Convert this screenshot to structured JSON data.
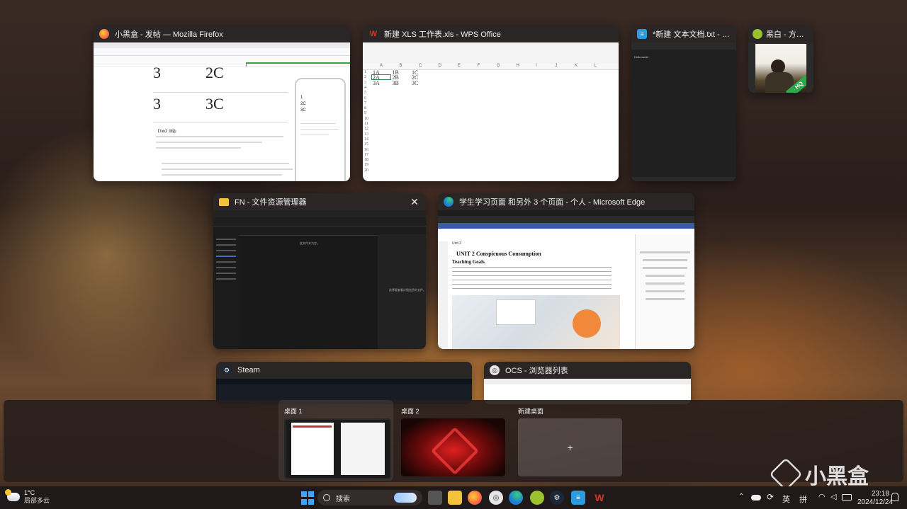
{
  "windows": {
    "firefox": {
      "title": "小黑盒 - 发帖 — Mozilla Firefox",
      "big1": "3",
      "big2": "2C",
      "big3": "3",
      "big4": "3C",
      "section": "【Tab】测验:",
      "phone_rows": [
        "1",
        "2C",
        "3C"
      ]
    },
    "wps": {
      "title": "新建 XLS 工作表.xls - WPS Office",
      "cols": [
        "A",
        "B",
        "C",
        "D",
        "E",
        "F",
        "G",
        "H",
        "I",
        "J",
        "K",
        "L"
      ],
      "rows": [
        [
          "1A",
          "1B",
          "1C"
        ],
        [
          "2A",
          "2B",
          "2C"
        ],
        [
          "3A",
          "3B",
          "3C"
        ]
      ],
      "row_numbers": [
        "1",
        "2",
        "3",
        "4",
        "5",
        "6",
        "7",
        "8",
        "9",
        "10",
        "11",
        "12",
        "13",
        "14",
        "15",
        "16",
        "17",
        "18",
        "19",
        "20"
      ]
    },
    "notepad": {
      "title": "*新建 文本文档.txt - Notepad",
      "content": "Hello world"
    },
    "music": {
      "title": "黑白 - 方大同",
      "badge": "HQ"
    },
    "explorer": {
      "title": "FN - 文件资源管理器",
      "close": "✕",
      "empty": "此文件夹为空。",
      "detail": "选择要查看详细信息的文件。"
    },
    "edge": {
      "title": "学生学习页面 和另外 3 个页面 - 个人 - Microsoft Edge",
      "unit": "Unit 2",
      "heading": "UNIT 2 Conspicuous Consumption",
      "subheading": "Teaching Goals"
    },
    "steam": {
      "title": "Steam"
    },
    "ocs": {
      "title": "OCS - 浏览器列表"
    }
  },
  "desktops": {
    "items": [
      {
        "label": "桌面 1"
      },
      {
        "label": "桌面 2"
      }
    ],
    "new_label": "新建桌面",
    "plus": "+"
  },
  "taskbar": {
    "weather_temp": "1°C",
    "weather_desc": "局部多云",
    "search_placeholder": "搜索",
    "ime1": "英",
    "ime2": "拼",
    "time": "23:18",
    "date": "2024/12/24"
  },
  "watermark": "小黑盒",
  "colors": {
    "accent": "#0a6cff",
    "wps_red": "#d9342b",
    "firefox_orange": "#ff7139",
    "edge_blue": "#1c7cd6"
  }
}
